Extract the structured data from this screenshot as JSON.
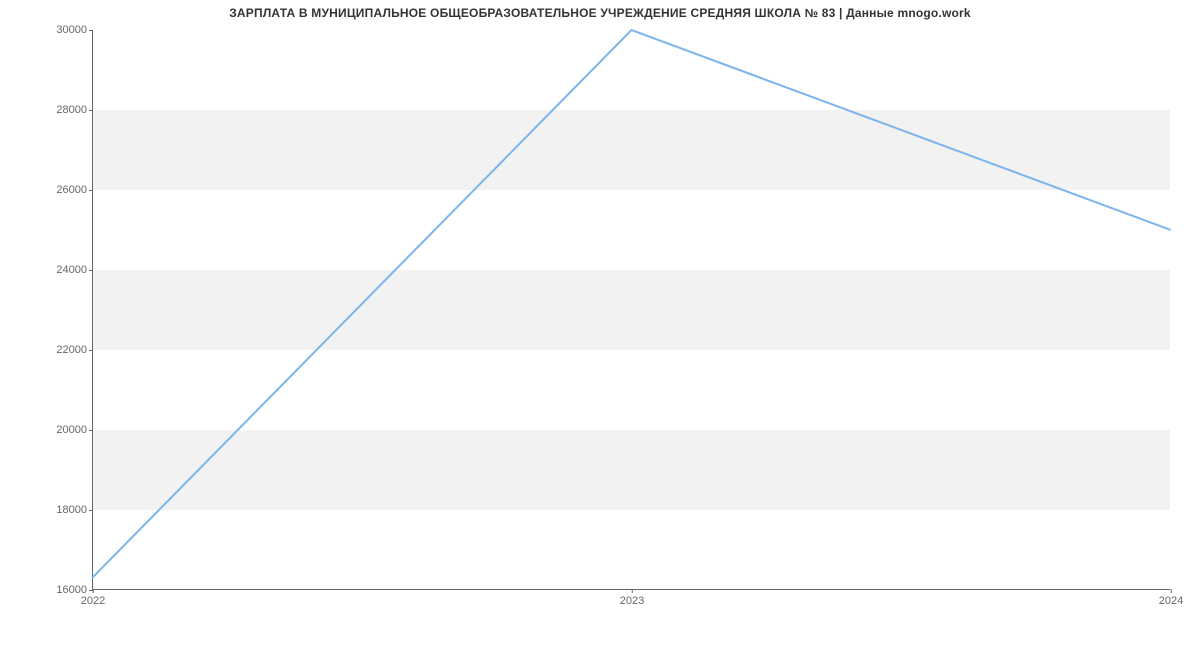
{
  "chart_data": {
    "type": "line",
    "title": "ЗАРПЛАТА В МУНИЦИПАЛЬНОЕ ОБЩЕОБРАЗОВАТЕЛЬНОЕ УЧРЕЖДЕНИЕ СРЕДНЯЯ ШКОЛА № 83 | Данные mnogo.work",
    "x": [
      2022,
      2023,
      2024
    ],
    "values": [
      16300,
      30000,
      25000
    ],
    "xlabel": "",
    "ylabel": "",
    "ylim": [
      16000,
      30000
    ],
    "y_ticks": [
      16000,
      18000,
      20000,
      22000,
      24000,
      26000,
      28000,
      30000
    ],
    "x_ticks": [
      2022,
      2023,
      2024
    ],
    "grid_bands": true,
    "series_color": "#7cb5ec"
  }
}
